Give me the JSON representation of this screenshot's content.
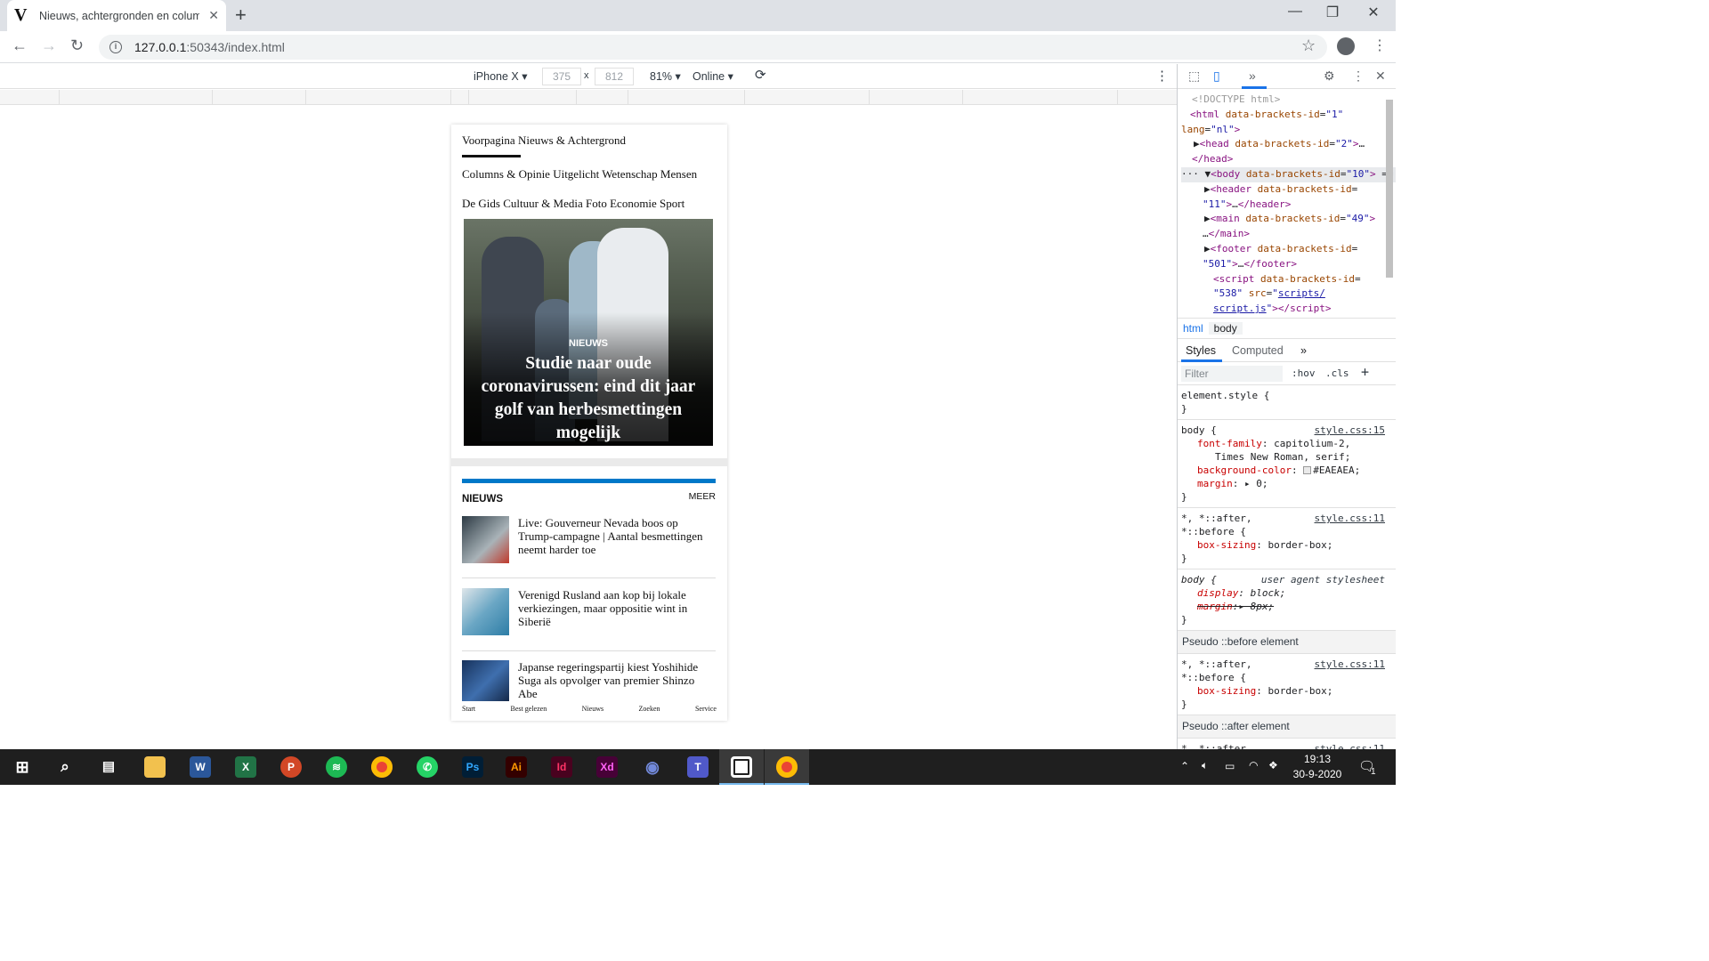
{
  "browser": {
    "tab_title": "Nieuws, achtergronden en colum",
    "favicon_letter": "V",
    "url_host": "127.0.0.1",
    "url_port_path": ":50343/index.html"
  },
  "device_toolbar": {
    "device": "iPhone X",
    "width": "375",
    "times": "x",
    "height": "812",
    "zoom": "81%",
    "throttle": "Online"
  },
  "page": {
    "nav_rows": [
      "Voorpagina Nieuws & Achtergrond",
      "Columns & Opinie Uitgelicht Wetenschap Mensen",
      "De Gids Cultuur & Media Foto Economie Sport"
    ],
    "hero": {
      "label": "NIEUWS",
      "title": "Studie naar oude coronavirussen: eind dit jaar golf van herbesmettingen mogelijk"
    },
    "news_section": {
      "heading": "NIEUWS",
      "more": "MEER",
      "accent_color": "#0078c8",
      "items": [
        "Live: Gouverneur Nevada boos op Trump-campagne | Aantal besmettingen neemt harder toe",
        "Verenigd Rusland aan kop bij lokale verkiezingen, maar oppositie wint in Siberië",
        "Japanse regeringspartij kiest Yoshihide Suga als opvolger van premier Shinzo Abe"
      ]
    },
    "bottom_tabs": [
      "Start",
      "Best gelezen",
      "Nieuws",
      "Zoeken",
      "Service"
    ]
  },
  "devtools": {
    "breadcrumbs": [
      "html",
      "body"
    ],
    "tabs": [
      "Styles",
      "Computed"
    ],
    "filter_placeholder": "Filter",
    "filter_hov": ":hov",
    "filter_cls": ".cls",
    "pseudo_before": "Pseudo ::before element",
    "pseudo_after": "Pseudo ::after element",
    "style_src_15": "style.css:15",
    "style_src_11": "style.css:11",
    "ua_label": "user agent stylesheet"
  },
  "taskbar": {
    "time": "19:13",
    "date": "30-9-2020",
    "notification_count": "1"
  }
}
